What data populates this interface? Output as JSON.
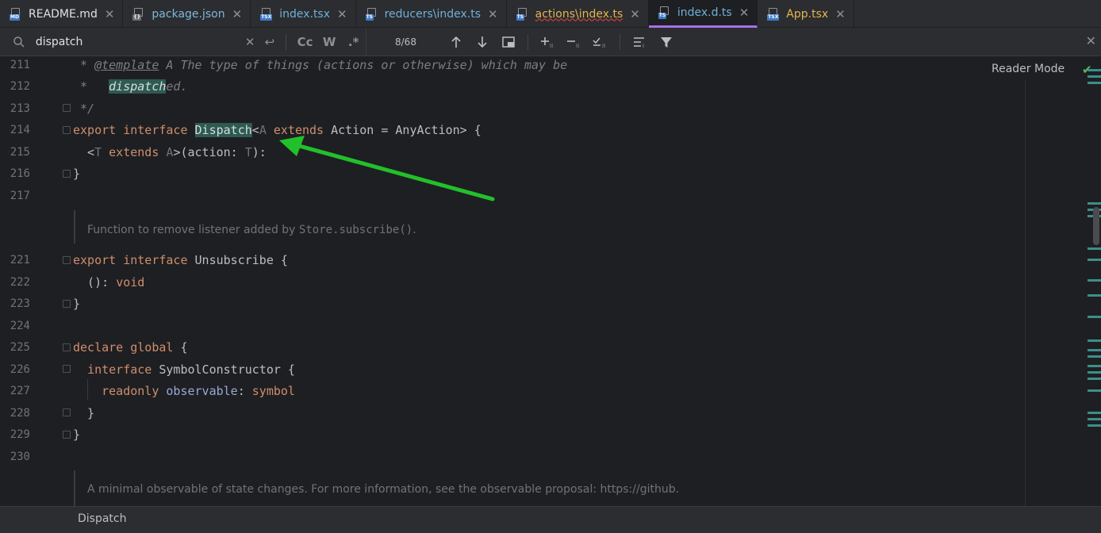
{
  "tabs": [
    {
      "label": "README.md",
      "badge": "MD",
      "badge_color": "#3d7ac7",
      "style": "md"
    },
    {
      "label": "package.json",
      "badge": "{}",
      "badge_color": "#8c8f96",
      "style": "json"
    },
    {
      "label": "index.tsx",
      "badge": "TSX",
      "badge_color": "#3d7ac7",
      "style": "tsx"
    },
    {
      "label": "reducers\\index.ts",
      "badge": "TS",
      "badge_color": "#3d7ac7",
      "style": "ts"
    },
    {
      "label": "actions\\index.ts",
      "badge": "TS",
      "badge_color": "#3d7ac7",
      "style": "err"
    },
    {
      "label": "index.d.ts",
      "badge": "TS",
      "badge_color": "#3d7ac7",
      "style": "ts",
      "active": true
    },
    {
      "label": "App.tsx",
      "badge": "TSX",
      "badge_color": "#3d7ac7",
      "style": "app"
    }
  ],
  "find": {
    "query": "dispatch",
    "match_case": "Cc",
    "words": "W",
    "regex": ".*",
    "count": "8/68"
  },
  "editor": {
    "reader_mode": "Reader Mode",
    "lines": [
      {
        "n": "211"
      },
      {
        "n": "212"
      },
      {
        "n": "213"
      },
      {
        "n": "214"
      },
      {
        "n": "215"
      },
      {
        "n": "216"
      },
      {
        "n": "217"
      },
      {
        "n": "221"
      },
      {
        "n": "222"
      },
      {
        "n": "223"
      },
      {
        "n": "224"
      },
      {
        "n": "225"
      },
      {
        "n": "226"
      },
      {
        "n": "227"
      },
      {
        "n": "228"
      },
      {
        "n": "229"
      },
      {
        "n": "230"
      }
    ],
    "c211_star": " * ",
    "c211_tag": "@template",
    "c211_rest": " A The type of things (actions or otherwise) which may be",
    "c212_star": " *   ",
    "c212_hl": "dispatch",
    "c212_rest": "ed.",
    "c213": " */",
    "c214_kw1": "export",
    "c214_kw2": "interface",
    "c214_name": "Dispatch",
    "c214_lt": "<",
    "c214_A": "A",
    "c214_kw3": "extends",
    "c214_rest": " Action = AnyAction> {",
    "c215_lt": "  <",
    "c215_T": "T",
    "c215_kw": "extends",
    "c215_A": "A",
    "c215_mid": ">(action: ",
    "c215_T2": "T",
    "c215_end": "):",
    "c216": "}",
    "doc1_text": "Function to remove listener added by ",
    "doc1_code": "Store.subscribe()",
    "doc1_end": ".",
    "c221_kw1": "export",
    "c221_kw2": "interface",
    "c221_rest": " Unsubscribe {",
    "c222_a": "  (): ",
    "c222_kw": "void",
    "c223": "}",
    "c225_kw1": "declare",
    "c225_kw2": "global",
    "c225_rest": " {",
    "c226_kw": "interface",
    "c226_rest": " SymbolConstructor {",
    "c227_kw": "readonly",
    "c227_prop": "observable",
    "c227_colon": ": ",
    "c227_type": "symbol",
    "c228": "  }",
    "c229": "}",
    "doc2_text": "A minimal observable of state changes. For more information, see the observable proposal: https://github."
  },
  "breadcrumb": "Dispatch",
  "colors": {
    "accent_tab": "#a571e6",
    "search_highlight": "#2e5a52",
    "arrow": "#22c02a",
    "marker": "#3a8f8a"
  }
}
